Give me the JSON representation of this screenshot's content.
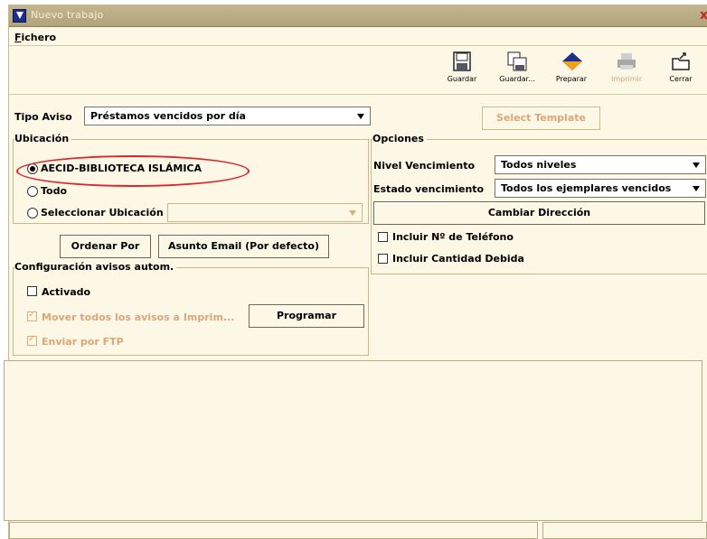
{
  "window": {
    "title": "Nuevo trabajo",
    "close": "x"
  },
  "menu": {
    "file": "Fichero"
  },
  "toolbar": {
    "buttons": [
      {
        "label": "Guardar",
        "icon": "floppy-disk-icon",
        "enabled": true
      },
      {
        "label": "Guardar...",
        "icon": "save-as-icon",
        "enabled": true
      },
      {
        "label": "Preparar",
        "icon": "diamond-icon",
        "enabled": true
      },
      {
        "label": "Imprimir",
        "icon": "printer-icon",
        "enabled": false
      },
      {
        "label": "Cerrar",
        "icon": "close-folder-icon",
        "enabled": true
      }
    ]
  },
  "tipo_aviso": {
    "label": "Tipo Aviso",
    "value": "Préstamos vencidos por día"
  },
  "select_template": "Select Template",
  "ubicacion": {
    "title": "Ubicación",
    "options": [
      "AECID-BIBLIOTECA ISLÁMICA",
      "Todo",
      "Seleccionar Ubicación"
    ],
    "selected_index": 0,
    "location_value": ""
  },
  "opciones": {
    "title": "Opciones",
    "nivel_label": "Nivel Vencimiento",
    "nivel_value": "Todos niveles",
    "estado_label": "Estado vencimiento",
    "estado_value": "Todos los ejemplares vencidos",
    "cambiar": "Cambiar Dirección",
    "incluir_telefono": "Incluir Nº de Teléfono",
    "incluir_cantidad": "Incluir Cantidad Debida"
  },
  "buttons": {
    "ordenar": "Ordenar Por",
    "asunto": "Asunto Email (Por defecto)"
  },
  "config": {
    "title": "Configuración avisos autom.",
    "activado": "Activado",
    "mover": "Mover todos los avisos a Imprim...",
    "programar": "Programar",
    "enviar": "Enviar por FTP"
  },
  "colors": {
    "background": "#fdf7e6",
    "titlebar": "#b1a47b",
    "highlight": "#e0222a",
    "disabled_text": "#d9a77a"
  }
}
